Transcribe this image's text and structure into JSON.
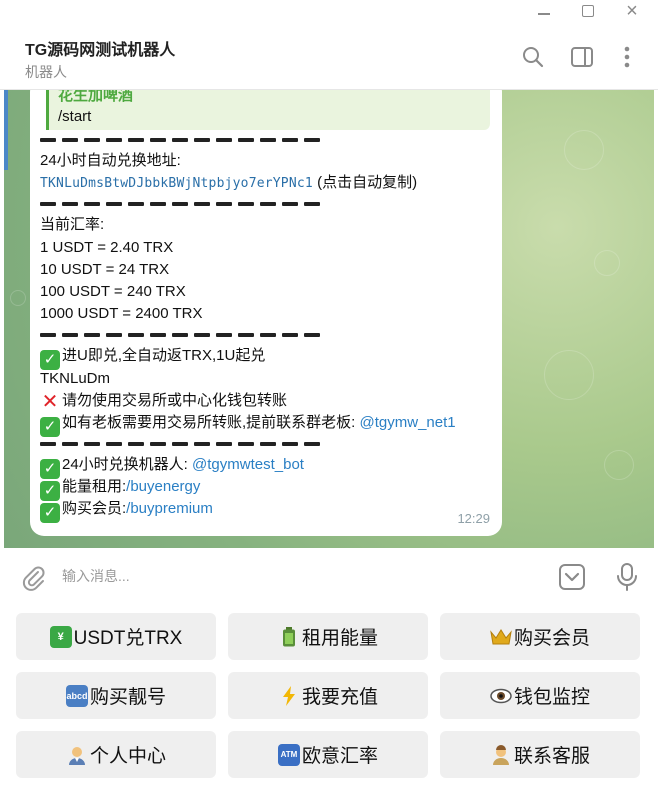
{
  "window": {
    "controls": {
      "minimize": "minimize-icon",
      "maximize": "maximize-icon",
      "close": "×"
    }
  },
  "header": {
    "title": "TG源码网测试机器人",
    "subtitle": "机器人"
  },
  "message": {
    "reply": {
      "sender": "花生加啤酒",
      "text": "/start"
    },
    "address_label": "24小时自动兑换地址:",
    "address": "TKNLuDmsBtwDJbbkBWjNtpbjyo7erYPNc1",
    "address_hint": "(点击自动复制)",
    "rate_title": "当前汇率:",
    "rates": [
      "1 USDT = 2.40 TRX",
      "10 USDT = 24 TRX",
      "100 USDT = 240 TRX",
      "1000 USDT = 2400 TRX"
    ],
    "notice1": "进U即兑,全自动返TRX,1U起兑",
    "notice1_cont": "TKNLuDm",
    "notice2": "请勿使用交易所或中心化钱包转账",
    "notice3": "如有老板需要用交易所转账,提前联系群老板:",
    "notice3_link": "@tgymw_net1",
    "bot_label": "24小时兑换机器人:",
    "bot_link": "@tgymwtest_bot",
    "energy_label": "能量租用:",
    "energy_link": "/buyenergy",
    "premium_label": "购买会员:",
    "premium_link": "/buypremium",
    "time": "12:29"
  },
  "input": {
    "placeholder": "输入消息..."
  },
  "keyboard": {
    "buttons": [
      {
        "label": "USDT兑TRX",
        "icon": "yen-exchange-icon",
        "color": "#3aa845"
      },
      {
        "label": "租用能量",
        "icon": "battery-icon",
        "color": "#5a8f3a"
      },
      {
        "label": "购买会员",
        "icon": "crown-icon",
        "color": "#e0a91b"
      },
      {
        "label": "购买靓号",
        "icon": "abcd-icon",
        "color": "#4a7fc4"
      },
      {
        "label": "我要充值",
        "icon": "lightning-icon",
        "color": "#f2b705"
      },
      {
        "label": "钱包监控",
        "icon": "eye-icon",
        "color": "#666666"
      },
      {
        "label": "个人中心",
        "icon": "person-icon",
        "color": "#d9a066"
      },
      {
        "label": "欧意汇率",
        "icon": "atm-icon",
        "color": "#3a6fc4"
      },
      {
        "label": "联系客服",
        "icon": "support-person-icon",
        "color": "#d9a066"
      }
    ]
  },
  "colors": {
    "accent": "#2a7fc4",
    "reply_green": "#4ea93f",
    "check_green": "#3cb043",
    "cross_red": "#e0242a"
  }
}
